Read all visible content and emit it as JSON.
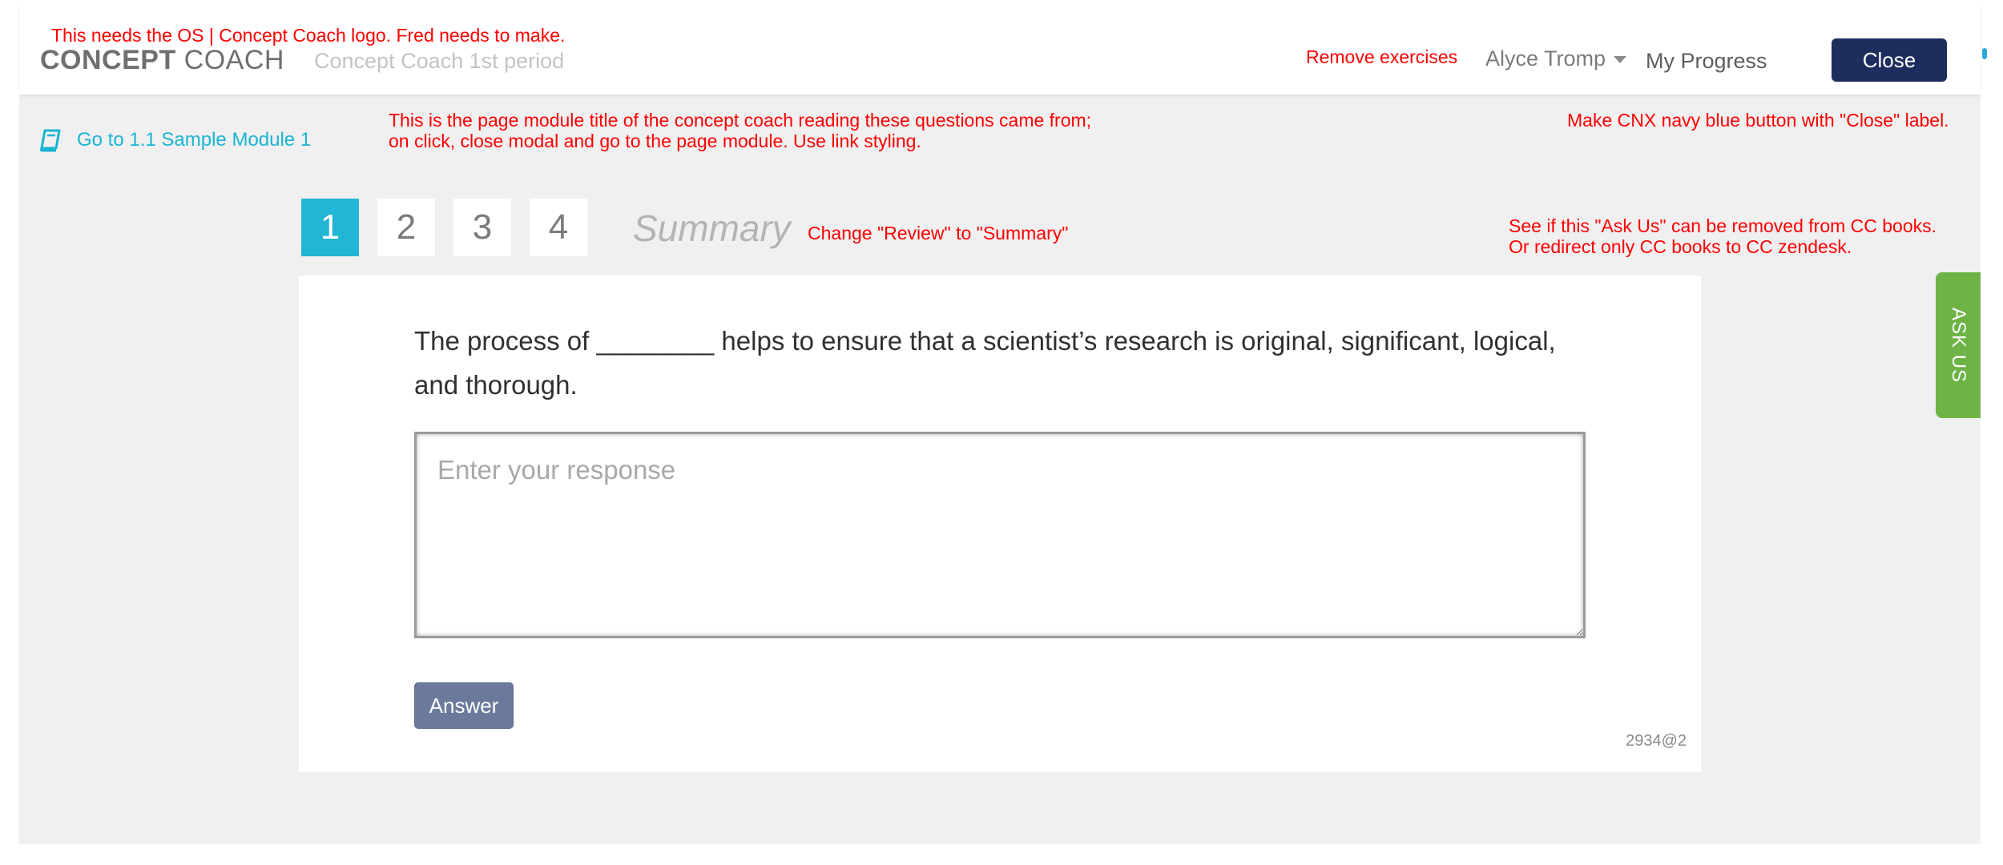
{
  "header": {
    "logo_bold": "CONCEPT",
    "logo_light": " COACH",
    "period": "Concept Coach 1st period",
    "remove_exercises": "Remove exercises",
    "user_name": "Alyce Tromp",
    "my_progress": "My Progress",
    "close_label": "Close"
  },
  "breadcrumb": {
    "back_link": "Go to 1.1 Sample Module 1"
  },
  "steps": [
    "1",
    "2",
    "3",
    "4"
  ],
  "summary_label": "Summary",
  "question": {
    "text": "The process of ________ helps to ensure that a scientist’s research is original, significant, logical, and thorough.",
    "placeholder": "Enter your response",
    "answer_label": "Answer",
    "uid": "2934@2"
  },
  "ask_us": "ASK US",
  "annotations": {
    "logo_note": "This needs the OS | Concept Coach logo.  Fred needs to make.",
    "title_note_line1": "This is the page module title of the concept coach reading these questions came from;",
    "title_note_line2": "on click, close modal and go to the page module.  Use link styling.",
    "close_note": "Make CNX navy blue button with \"Close\" label.",
    "summary_note": "Change \"Review\" to \"Summary\"",
    "askus_note_line1": "See if this \"Ask Us\" can be removed from CC books.",
    "askus_note_line2": "Or redirect only CC books to CC zendesk."
  },
  "colors": {
    "accent": "#21b6d4",
    "close_button": "#1c2d5e",
    "answer_button": "#6b7a9a",
    "ask_us": "#6eb346",
    "annotation": "#ff0000"
  }
}
